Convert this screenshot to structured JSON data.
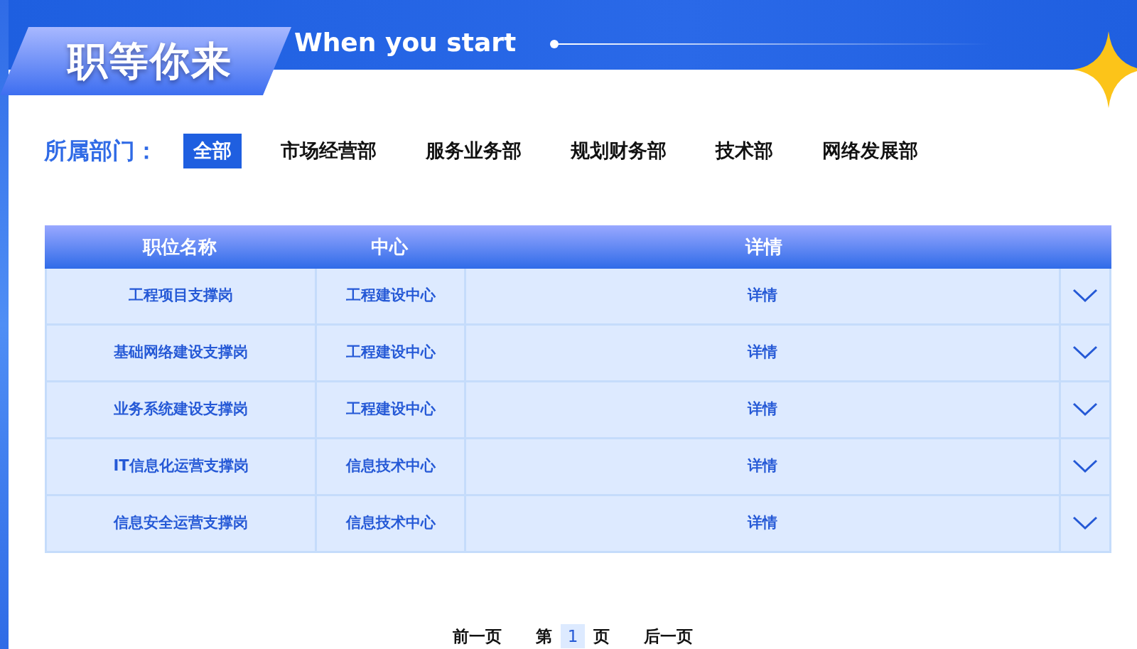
{
  "header": {
    "title": "职等你来",
    "subtitle": "When you start"
  },
  "filter": {
    "label": "所属部门：",
    "departments": [
      {
        "label": "全部",
        "selected": true
      },
      {
        "label": "市场经营部",
        "selected": false
      },
      {
        "label": "服务业务部",
        "selected": false
      },
      {
        "label": "规划财务部",
        "selected": false
      },
      {
        "label": "技术部",
        "selected": false
      },
      {
        "label": "网络发展部",
        "selected": false
      }
    ]
  },
  "table": {
    "columns": [
      "职位名称",
      "中心",
      "详情"
    ],
    "rows": [
      {
        "position": "工程项目支撑岗",
        "center": "工程建设中心",
        "detail": "详情",
        "expanded": false
      },
      {
        "position": "基础网络建设支撑岗",
        "center": "工程建设中心",
        "detail": "详情",
        "expanded": false
      },
      {
        "position": "业务系统建设支撑岗",
        "center": "工程建设中心",
        "detail": "详情",
        "expanded": false
      },
      {
        "position": "IT信息化运营支撑岗",
        "center": "信息技术中心",
        "detail": "详情",
        "expanded": false
      },
      {
        "position": "信息安全运营支撑岗",
        "center": "信息技术中心",
        "detail": "详情",
        "expanded": false
      }
    ]
  },
  "pagination": {
    "prev": "前一页",
    "page_prefix": "第",
    "page": "1",
    "page_suffix": "页",
    "next": "后一页"
  }
}
